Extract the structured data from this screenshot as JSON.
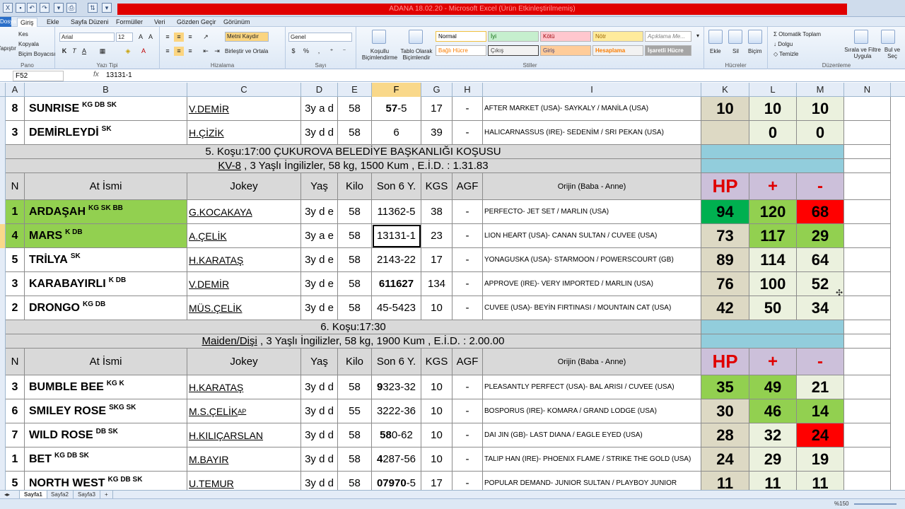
{
  "app": {
    "title": "ADANA 18.02.20 - Microsoft Excel (Ürün Etkinleştirilmemiş)",
    "file_tab": "Dosya",
    "tabs": [
      "Giriş",
      "Ekle",
      "Sayfa Düzeni",
      "Formüller",
      "Veri",
      "Gözden Geçir",
      "Görünüm"
    ]
  },
  "ribbon": {
    "clipboard": {
      "label": "Pano",
      "cut": "Kes",
      "copy": "Kopyala",
      "painter": "Biçim Boyacısı",
      "paste": "Yapıştır"
    },
    "font": {
      "label": "Yazı Tipi",
      "name": "Arial",
      "size": "12"
    },
    "alignment": {
      "label": "Hizalama",
      "wrap": "Metni Kaydır",
      "merge": "Birleştir ve Ortala"
    },
    "number": {
      "label": "Sayı",
      "format": "Genel"
    },
    "styles": {
      "label": "Stiller",
      "conditional": "Koşullu Biçimlendirme",
      "table": "Tablo Olarak Biçimlendir",
      "items": [
        "Normal",
        "İyi",
        "Kötü",
        "Nötr",
        "Açıklama Me...",
        "Bağlı Hücre",
        "Çıkış",
        "Giriş",
        "Hesaplama",
        "İşaretli Hücre"
      ]
    },
    "cells": {
      "label": "Hücreler",
      "insert": "Ekle",
      "delete": "Sil",
      "format": "Biçim"
    },
    "editing": {
      "label": "Düzenleme",
      "autosum": "Otomatik Toplam",
      "fill": "Dolgu",
      "clear": "Temizle",
      "sort": "Sırala ve Filtre Uygula",
      "find": "Bul ve Seç"
    }
  },
  "formula_bar": {
    "name_box": "F52",
    "fx": "fx",
    "value": "13131-1"
  },
  "columns": [
    "A",
    "B",
    "C",
    "D",
    "E",
    "F",
    "G",
    "H",
    "I",
    "K",
    "L",
    "M",
    "N"
  ],
  "selected_column": "F",
  "header_labels": {
    "n": "N",
    "at": "At İsmi",
    "jokey": "Jokey",
    "yas": "Yaş",
    "kilo": "Kilo",
    "son6": "Son 6 Y.",
    "kgs": "KGS",
    "agf": "AGF",
    "orijin": "Orijin (Baba - Anne)",
    "hp": "HP",
    "plus": "+",
    "minus": "-"
  },
  "block1": [
    {
      "n": "8",
      "name": "SUNRISE",
      "tags": "KG DB SK",
      "jockey": "V.DEMİR",
      "jsup": "",
      "age": "3y a d",
      "kilo": "58",
      "son6_bold": "57",
      "son6_rest": "-5",
      "kgs": "17",
      "agf": "-",
      "orijin": "AFTER MARKET (USA)- SAYKALY / MANİLA (USA)",
      "hp": "10",
      "plus": "10",
      "minus": "10"
    },
    {
      "n": "3",
      "name": "DEMİRLEYDİ",
      "tags": "SK",
      "jockey": "H.ÇİZİK",
      "jsup": "",
      "age": "3y d d",
      "kilo": "58",
      "son6_bold": "",
      "son6_rest": "6",
      "kgs": "39",
      "agf": "-",
      "orijin": "HALICARNASSUS (IRE)- SEDENİM / SRI PEKAN (USA)",
      "hp": "",
      "plus": "0",
      "minus": "0"
    }
  ],
  "race5": {
    "title": "5. Koşu:17:00 ÇUKUROVA BELEDİYE BAŞKANLIĞI KOŞUSU",
    "cond_u": "KV-8",
    "cond_rest": " , 3 Yaşlı İngilizler, 58 kg, 1500 Kum , E.İ.D. : 1.31.83",
    "rows": [
      {
        "n": "1",
        "name": "ARDAŞAH",
        "tags": "KG SK BB",
        "jockey": "G.KOCAKAYA",
        "jsup": "",
        "age": "3y d e",
        "kilo": "58",
        "son6_bold": "",
        "son6_rest": "11362-5",
        "kgs": "38",
        "agf": "-",
        "orijin": "PERFECTO- JET SET / MARLIN (USA)",
        "hp": "94",
        "plus": "120",
        "minus": "68"
      },
      {
        "n": "4",
        "name": "MARS",
        "tags": "K DB",
        "jockey": "A.ÇELİK",
        "jsup": "",
        "age": "3y a e",
        "kilo": "58",
        "son6_bold": "",
        "son6_rest": "13131-1",
        "kgs": "23",
        "agf": "-",
        "orijin": "LION HEART (USA)- CANAN SULTAN / CUVEE (USA)",
        "hp": "73",
        "plus": "117",
        "minus": "29"
      },
      {
        "n": "5",
        "name": "TRİLYA",
        "tags": "SK",
        "jockey": "H.KARATAŞ",
        "jsup": "",
        "age": "3y d e",
        "kilo": "58",
        "son6_bold": "",
        "son6_rest": "2143-22",
        "kgs": "17",
        "agf": "-",
        "orijin": "YONAGUSKA (USA)- STARMOON / POWERSCOURT (GB)",
        "hp": "89",
        "plus": "114",
        "minus": "64"
      },
      {
        "n": "3",
        "name": "KARABAYIRLI",
        "tags": "K DB",
        "jockey": "V.DEMİR",
        "jsup": "",
        "age": "3y d e",
        "kilo": "58",
        "son6_bold": "611627",
        "son6_rest": "",
        "kgs": "134",
        "agf": "-",
        "orijin": "APPROVE (IRE)- VERY IMPORTED / MARLIN (USA)",
        "hp": "76",
        "plus": "100",
        "minus": "52"
      },
      {
        "n": "2",
        "name": "DRONGO",
        "tags": "KG DB",
        "jockey": "MÜS.ÇELİK",
        "jsup": "",
        "age": "3y d e",
        "kilo": "58",
        "son6_bold": "",
        "son6_rest": "45-5423",
        "kgs": "10",
        "agf": "-",
        "orijin": "CUVEE (USA)- BEYİN FIRTINASI / MOUNTAIN CAT (USA)",
        "hp": "42",
        "plus": "50",
        "minus": "34"
      }
    ]
  },
  "race6": {
    "title": "6. Koşu:17:30",
    "cond_u": "Maiden/Dişi",
    "cond_rest": " , 3 Yaşlı İngilizler, 58 kg, 1900 Kum , E.İ.D. : 2.00.00",
    "rows": [
      {
        "n": "3",
        "name": "BUMBLE BEE",
        "tags": "KG K",
        "jockey": "H.KARATAŞ",
        "jsup": "",
        "age": "3y d d",
        "kilo": "58",
        "son6_bold": "9",
        "son6_rest": "323-32",
        "kgs": "10",
        "agf": "-",
        "orijin": "PLEASANTLY PERFECT (USA)- BAL ARISI / CUVEE (USA)",
        "hp": "35",
        "plus": "49",
        "minus": "21"
      },
      {
        "n": "6",
        "name": "SMILEY ROSE",
        "tags": "SKG SK",
        "jockey": "M.S.ÇELİK",
        "jsup": "AP",
        "age": "3y d d",
        "kilo": "55",
        "son6_bold": "",
        "son6_rest": "3222-36",
        "kgs": "10",
        "agf": "-",
        "orijin": "BOSPORUS (IRE)- KOMARA / GRAND LODGE (USA)",
        "hp": "30",
        "plus": "46",
        "minus": "14"
      },
      {
        "n": "7",
        "name": "WILD ROSE",
        "tags": "DB SK",
        "jockey": "H.KILIÇARSLAN",
        "jsup": "",
        "age": "3y d d",
        "kilo": "58",
        "son6_bold": "58",
        "son6_rest": "0-62",
        "kgs": "10",
        "agf": "-",
        "orijin": "DAI JIN (GB)- LAST DIANA / EAGLE EYED (USA)",
        "hp": "28",
        "plus": "32",
        "minus": "24"
      },
      {
        "n": "1",
        "name": "BET",
        "tags": "KG DB SK",
        "jockey": "M.BAYIR",
        "jsup": "",
        "age": "3y d d",
        "kilo": "58",
        "son6_bold": "4",
        "son6_rest": "287-56",
        "kgs": "10",
        "agf": "-",
        "orijin": "TALIP HAN (IRE)- PHOENIX FLAME / STRIKE THE GOLD (USA)",
        "hp": "24",
        "plus": "29",
        "minus": "19"
      },
      {
        "n": "5",
        "name": "NORTH WEST",
        "tags": "KG DB SK",
        "jockey": "U.TEMUR",
        "jsup": "",
        "age": "3y d d",
        "kilo": "58",
        "son6_bold": "07970",
        "son6_rest": "-5",
        "kgs": "17",
        "agf": "-",
        "orijin": "POPULAR DEMAND- JUNIOR SULTAN / PLAYBOY JUNIOR",
        "hp": "11",
        "plus": "11",
        "minus": "11"
      }
    ]
  },
  "sheets": [
    "Sayfa1",
    "Sayfa2",
    "Sayfa3"
  ],
  "status": {
    "zoom": "%150"
  },
  "colors": {
    "green": "#92d050",
    "dark_green": "#00b050",
    "red": "#ff0000",
    "tan": "#ddd9c4",
    "light_green": "#ebf1de",
    "cyan": "#92cddc",
    "lavender": "#ccc0da",
    "grey": "#d9d9d9"
  }
}
